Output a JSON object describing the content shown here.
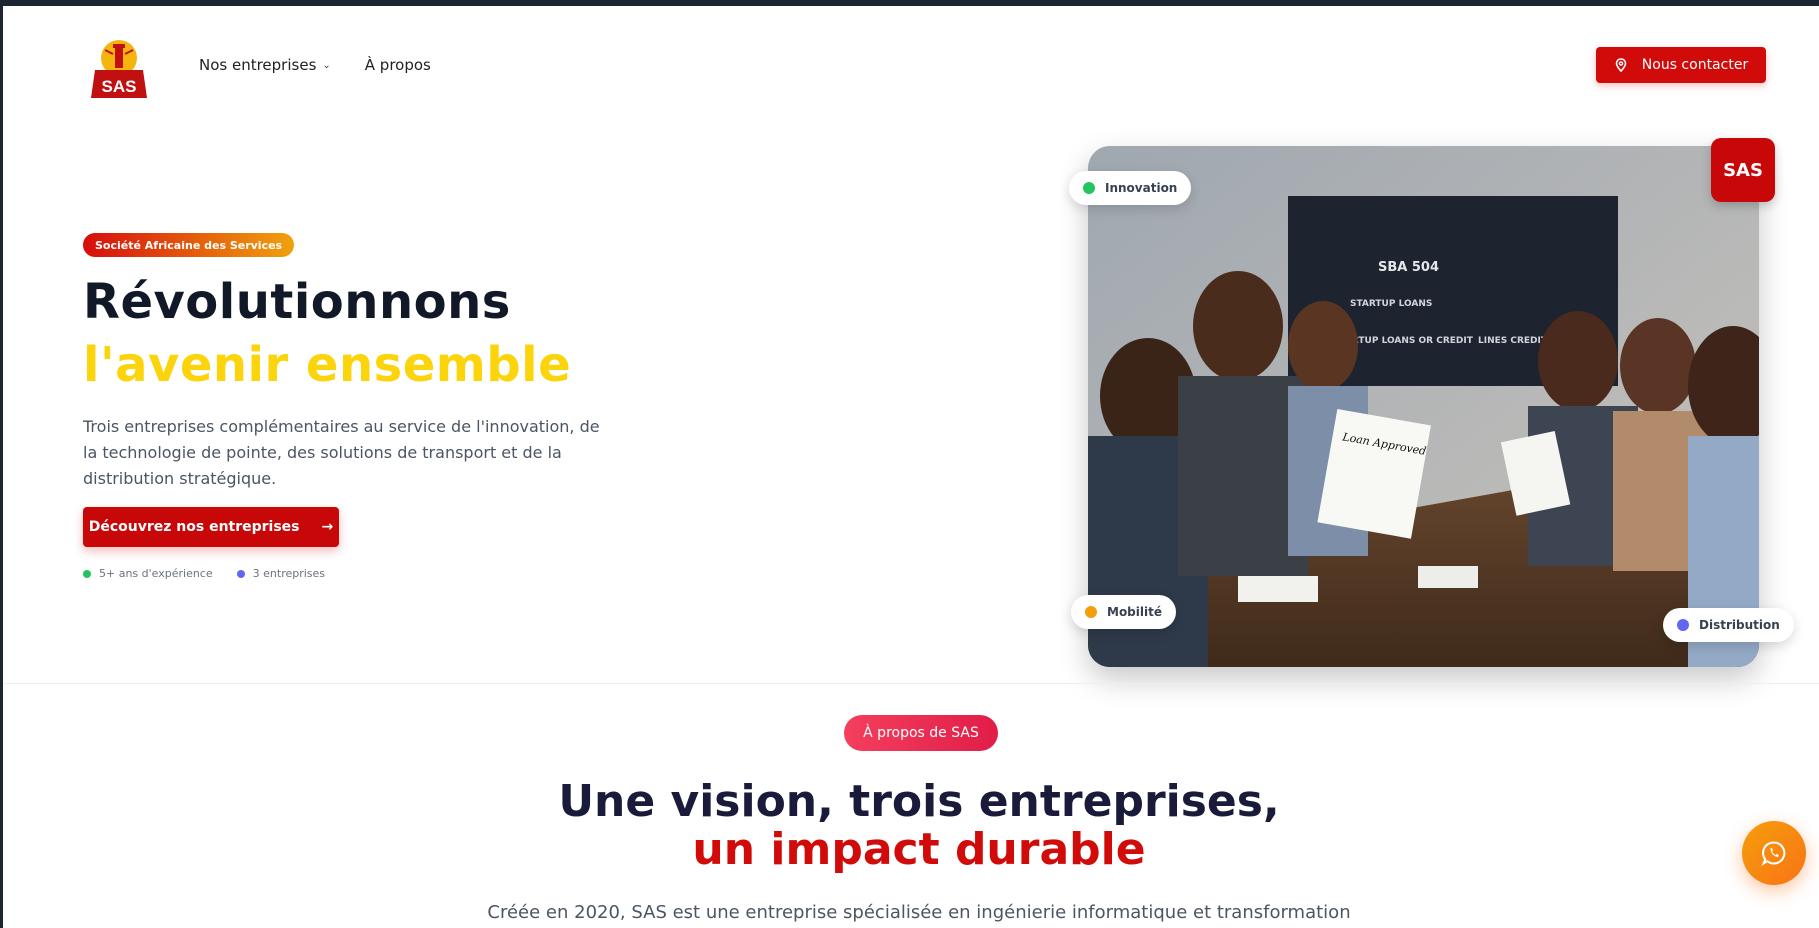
{
  "header": {
    "logo_text": "SAS",
    "nav": [
      {
        "label": "Nos entreprises",
        "has_dropdown": true
      },
      {
        "label": "À propos",
        "has_dropdown": false
      }
    ],
    "contact_label": "Nous contacter"
  },
  "hero": {
    "badge": "Société Africaine des Services",
    "title_line1": "Révolutionnons",
    "title_line2": "l'avenir ensemble",
    "description": "Trois entreprises complémentaires au service de l'innovation, de la technologie de pointe, des solutions de transport et de la distribution stratégique.",
    "cta_label": "Découvrez nos entreprises",
    "stats": [
      {
        "label": "5+ ans d'expérience",
        "color": "#22c55e"
      },
      {
        "label": "3 entreprises",
        "color": "#6366f1"
      }
    ]
  },
  "photo": {
    "corner_tag": "SAS",
    "screen_lines": [
      "SBA 504",
      "STARTUP LOANS",
      "STARTUP LOANS OR CREDIT",
      "LINES CREDIT"
    ],
    "paper_text": "Loan Approved",
    "pills": [
      {
        "label": "Innovation",
        "color": "#22c55e"
      },
      {
        "label": "Mobilité",
        "color": "#f59e0b"
      },
      {
        "label": "Distribution",
        "color": "#6366f1"
      }
    ]
  },
  "about": {
    "badge": "À propos de SAS",
    "title_line1": "Une vision, trois entreprises,",
    "title_line2": "un impact durable",
    "description": "Créée en 2020, SAS est une entreprise spécialisée en ingénierie informatique et transformation"
  },
  "colors": {
    "brand_red": "#d10a0a",
    "accent_yellow": "#fbd40c",
    "whatsapp_orange": "#f97316"
  }
}
